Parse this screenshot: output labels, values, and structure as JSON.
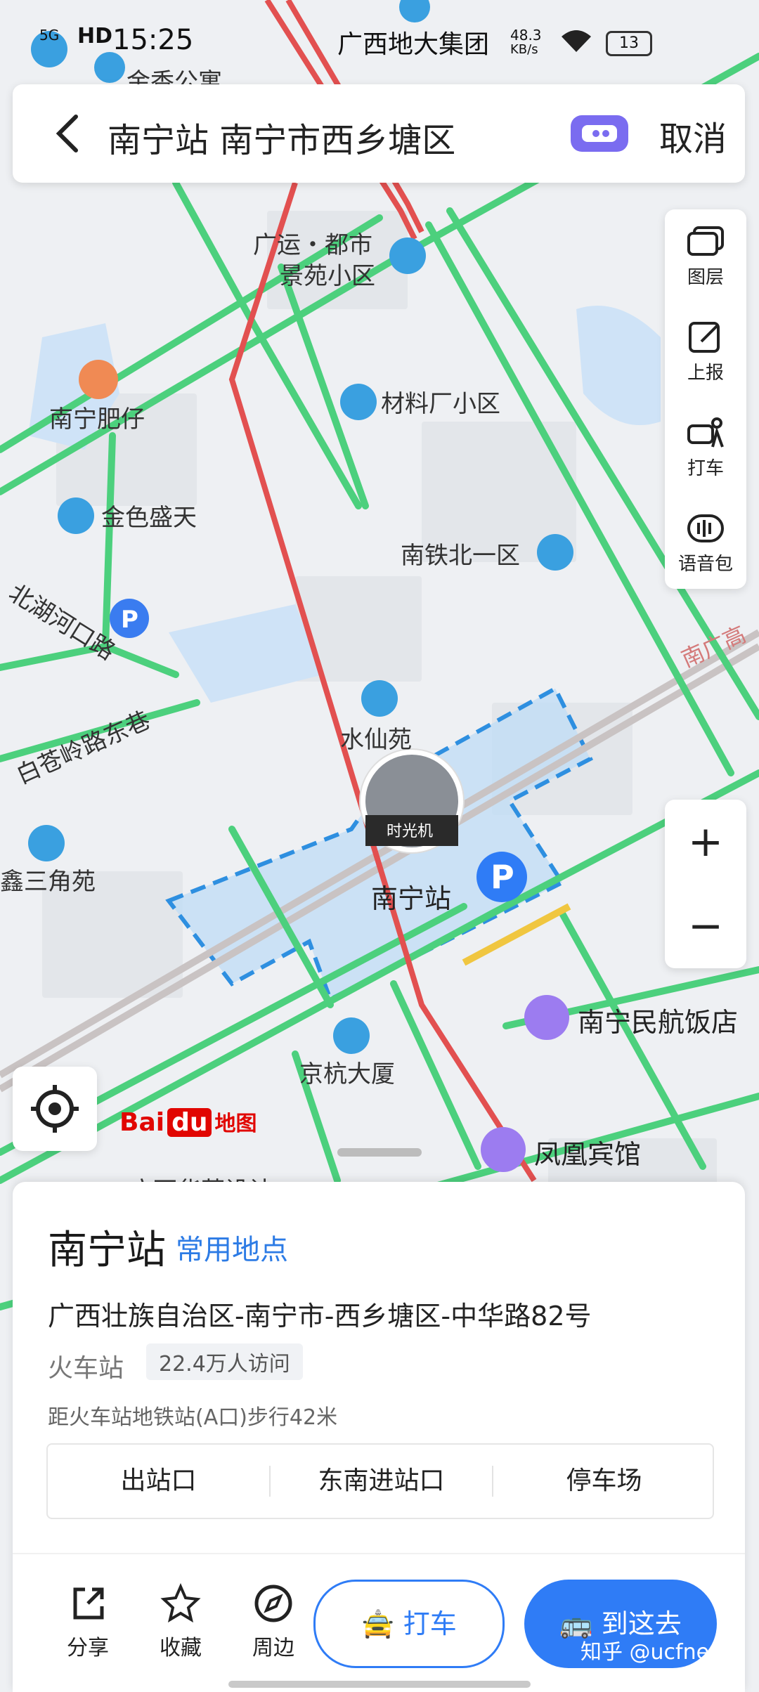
{
  "status_bar": {
    "network": "5G",
    "hd": "HD",
    "time": "15:25",
    "carrier_text": "广西地大集团",
    "speed_value": "48.3",
    "speed_unit": "KB/s",
    "battery": "13"
  },
  "search": {
    "query": "南宁站 南宁市西乡塘区",
    "cancel_label": "取消"
  },
  "tools": [
    {
      "label": "图层",
      "icon": "layers-icon"
    },
    {
      "label": "上报",
      "icon": "report-icon"
    },
    {
      "label": "打车",
      "icon": "taxi-icon"
    },
    {
      "label": "语音包",
      "icon": "voice-pack-icon"
    }
  ],
  "zoom": {
    "in_label": "+",
    "out_label": "−"
  },
  "map": {
    "labels": {
      "top_partial": "金香公寓",
      "guangyun_1": "广运・都市",
      "guangyun_2": "景苑小区",
      "nanning_feizai": "南宁肥仔",
      "cailiao": "材料厂小区",
      "jinse": "金色盛天",
      "nantie": "南铁北一区",
      "road1": "北湖河口路",
      "road2": "白苍岭路东巷",
      "shuixian": "水仙苑",
      "time_machine": "时光机",
      "station": "南宁站",
      "xinsanjiao": "鑫三角苑",
      "minhang": "南宁民航饭店",
      "jinghang": "京杭大厦",
      "fenghuang": "凤凰宾馆",
      "nanguang": "南广高",
      "bottom_partial": "广西华莱设计"
    },
    "logo": {
      "bai": "Bai",
      "du": "du",
      "suffix": "地图"
    }
  },
  "place": {
    "name": "南宁站",
    "tag": "常用地点",
    "address": "广西壮族自治区-南宁市-西乡塘区-中华路82号",
    "category": "火车站",
    "visits": "22.4万人访问",
    "metro": "距火车站地铁站(A口)步行42米",
    "entrances": [
      "出站口",
      "东南进站口",
      "停车场"
    ]
  },
  "actions": [
    {
      "label": "分享",
      "icon": "share-icon"
    },
    {
      "label": "收藏",
      "icon": "star-icon"
    },
    {
      "label": "周边",
      "icon": "compass-icon"
    }
  ],
  "buttons": {
    "taxi": "打车",
    "go": "到这去"
  },
  "watermark": "知乎 @ucfneeq",
  "colors": {
    "accent": "#2f7cf6",
    "road_green": "#4cd07d",
    "road_red": "#e64a4a",
    "poi_blue": "#3aa0e0"
  }
}
